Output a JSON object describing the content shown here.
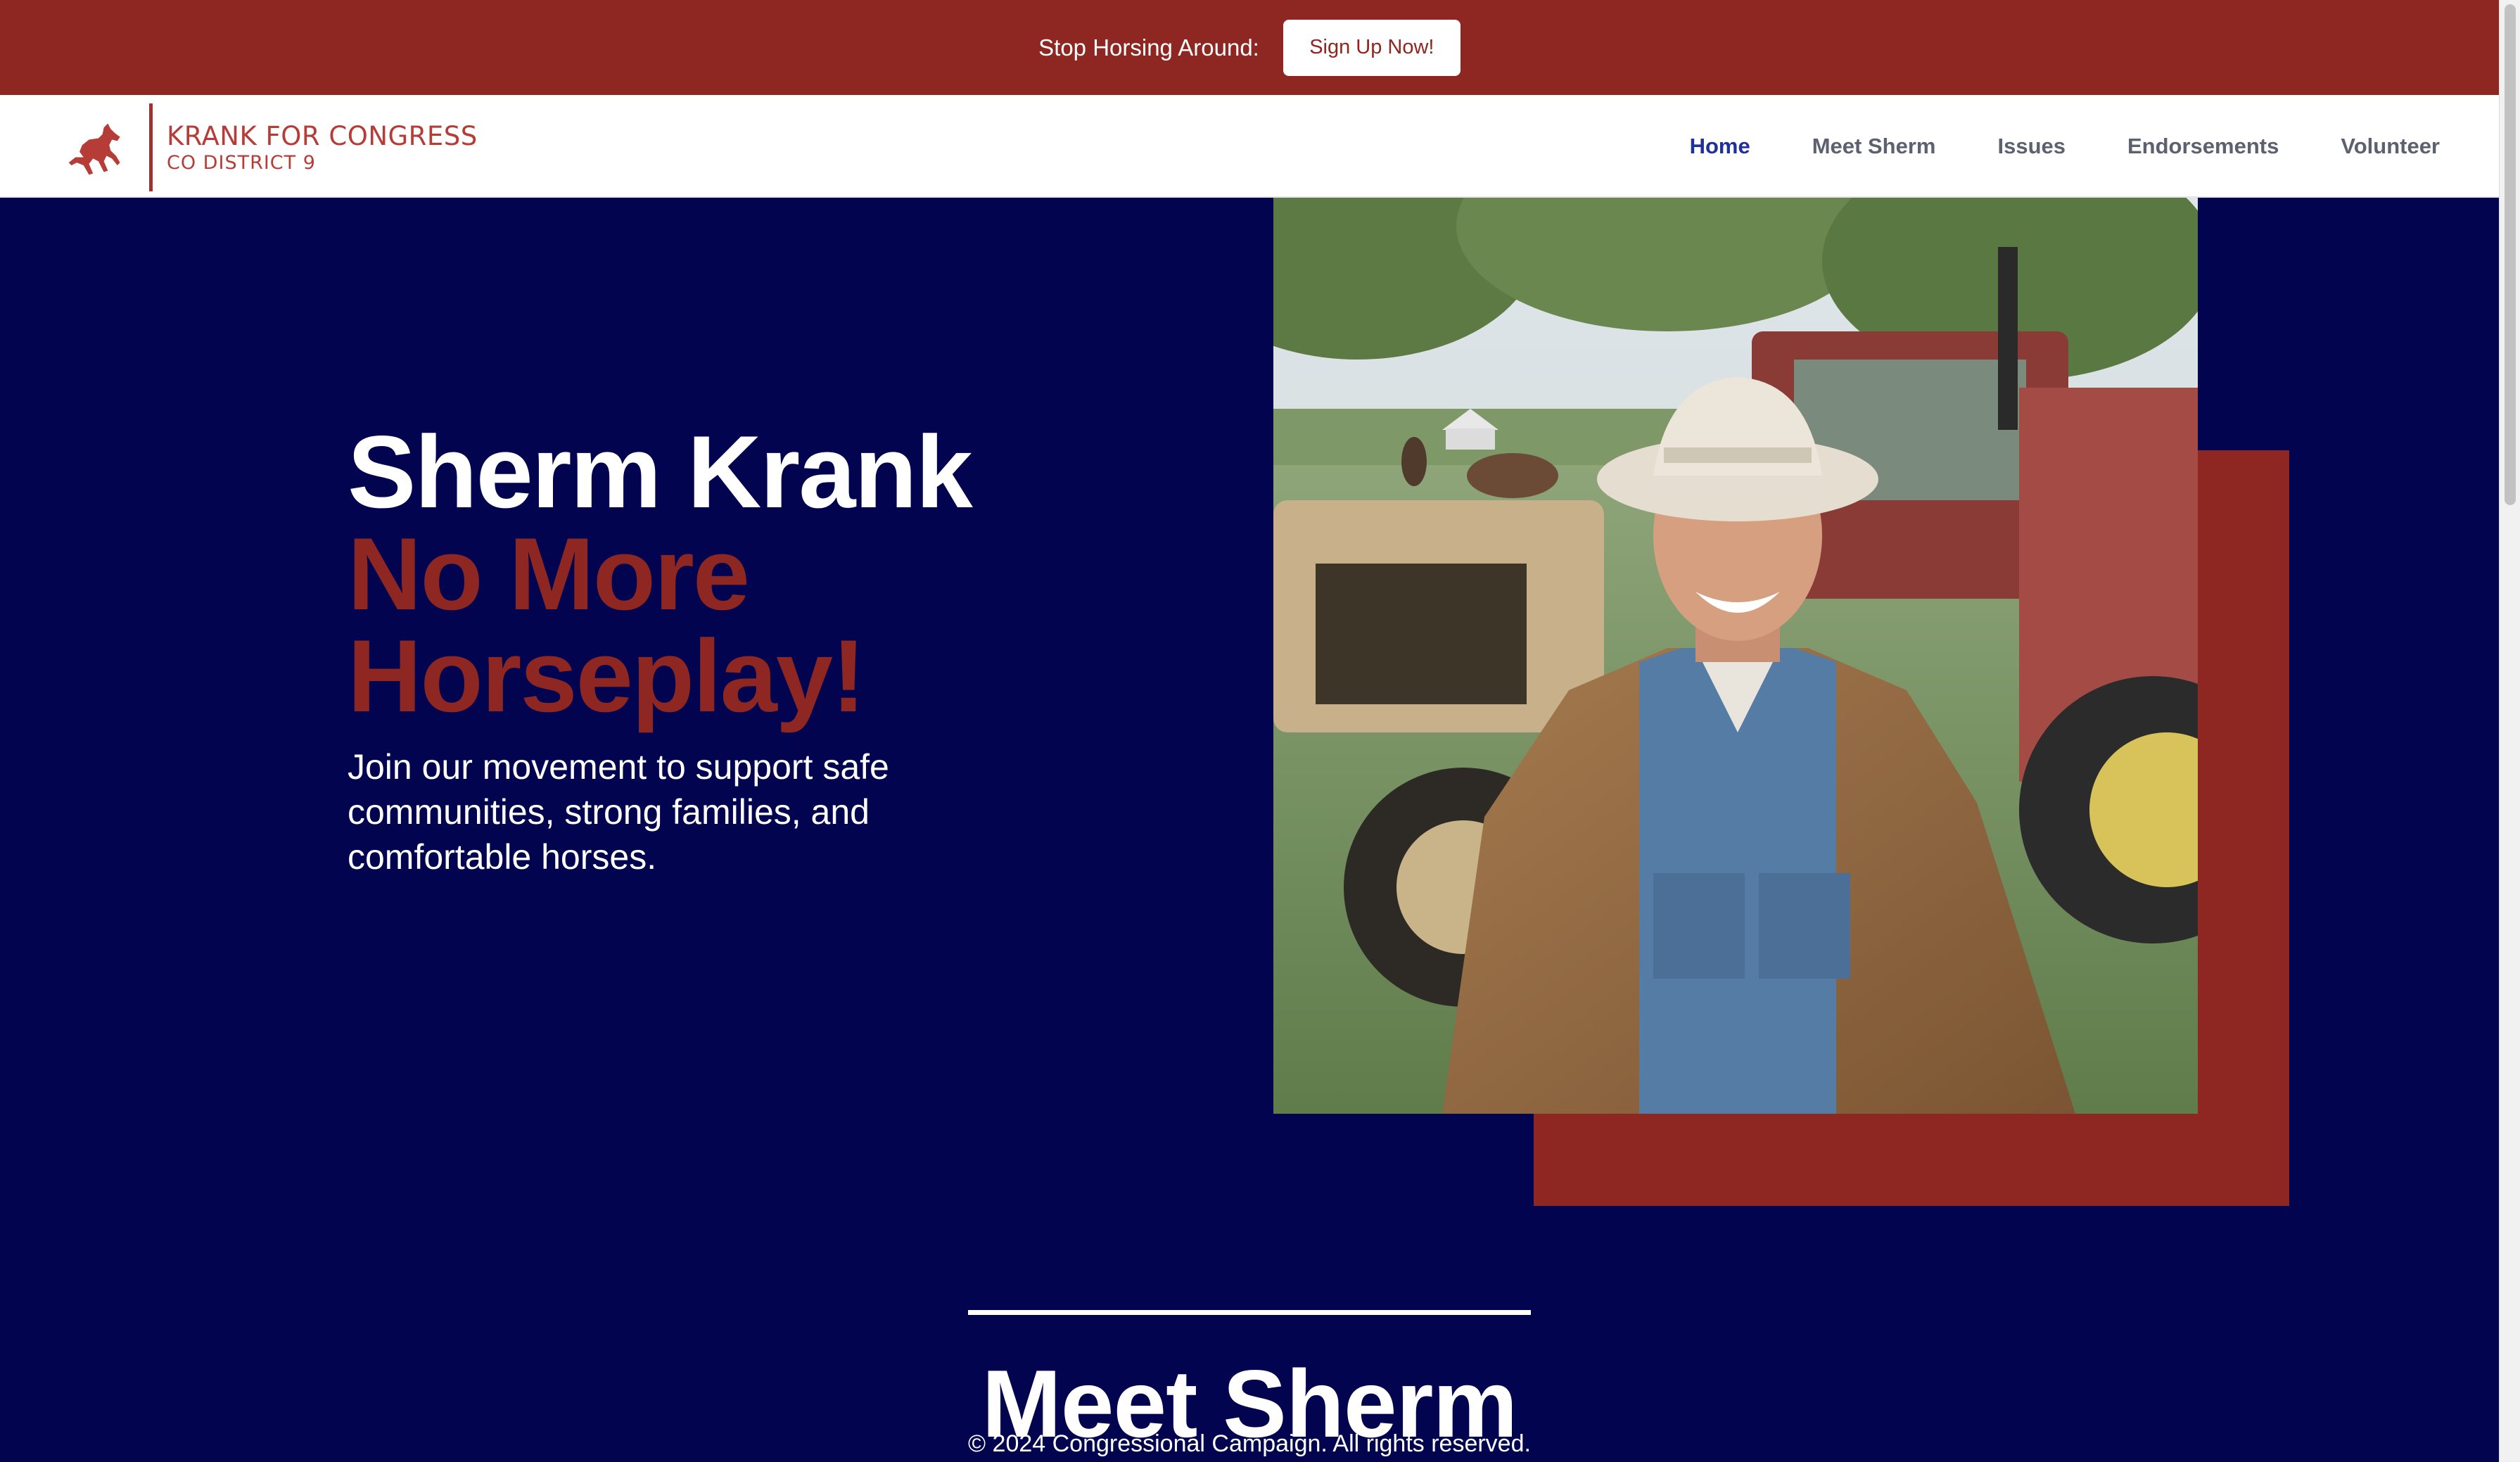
{
  "announcement": {
    "text": "Stop Horsing Around:",
    "button_label": "Sign Up Now!"
  },
  "brand": {
    "title": "KRANK FOR CONGRESS",
    "subtitle": "CO DISTRICT 9",
    "logo_icon": "horse-icon",
    "color": "#8e2622"
  },
  "nav": {
    "items": [
      {
        "label": "Home",
        "active": true
      },
      {
        "label": "Meet Sherm",
        "active": false
      },
      {
        "label": "Issues",
        "active": false
      },
      {
        "label": "Endorsements",
        "active": false
      },
      {
        "label": "Volunteer",
        "active": false
      }
    ],
    "active_color": "#1f2f9c"
  },
  "hero": {
    "name": "Sherm Krank",
    "slogan_line1": "No More",
    "slogan_line2": "Horseplay!",
    "description": "Join our movement to support safe communities, strong families, and comfortable horses.",
    "background_color": "#02044f",
    "accent_color": "#8e2622"
  },
  "meet_section": {
    "heading": "Meet Sherm"
  },
  "footer": {
    "copyright": "© 2024 Congressional Campaign. All rights reserved."
  }
}
